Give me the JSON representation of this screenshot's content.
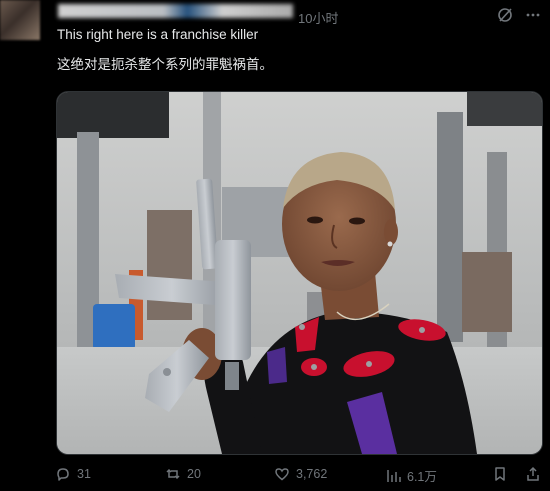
{
  "post": {
    "time": "10小时",
    "text_en": "This right here is a franchise killer",
    "text_zh": "这绝对是扼杀整个系列的罪魁祸首。"
  },
  "actions": {
    "replies": "31",
    "retweets": "20",
    "likes": "3,762",
    "views": "6.1万"
  },
  "icons": [
    "grok-icon",
    "more-icon",
    "reply-icon",
    "retweet-icon",
    "like-icon",
    "views-icon",
    "bookmark-icon",
    "share-icon"
  ]
}
